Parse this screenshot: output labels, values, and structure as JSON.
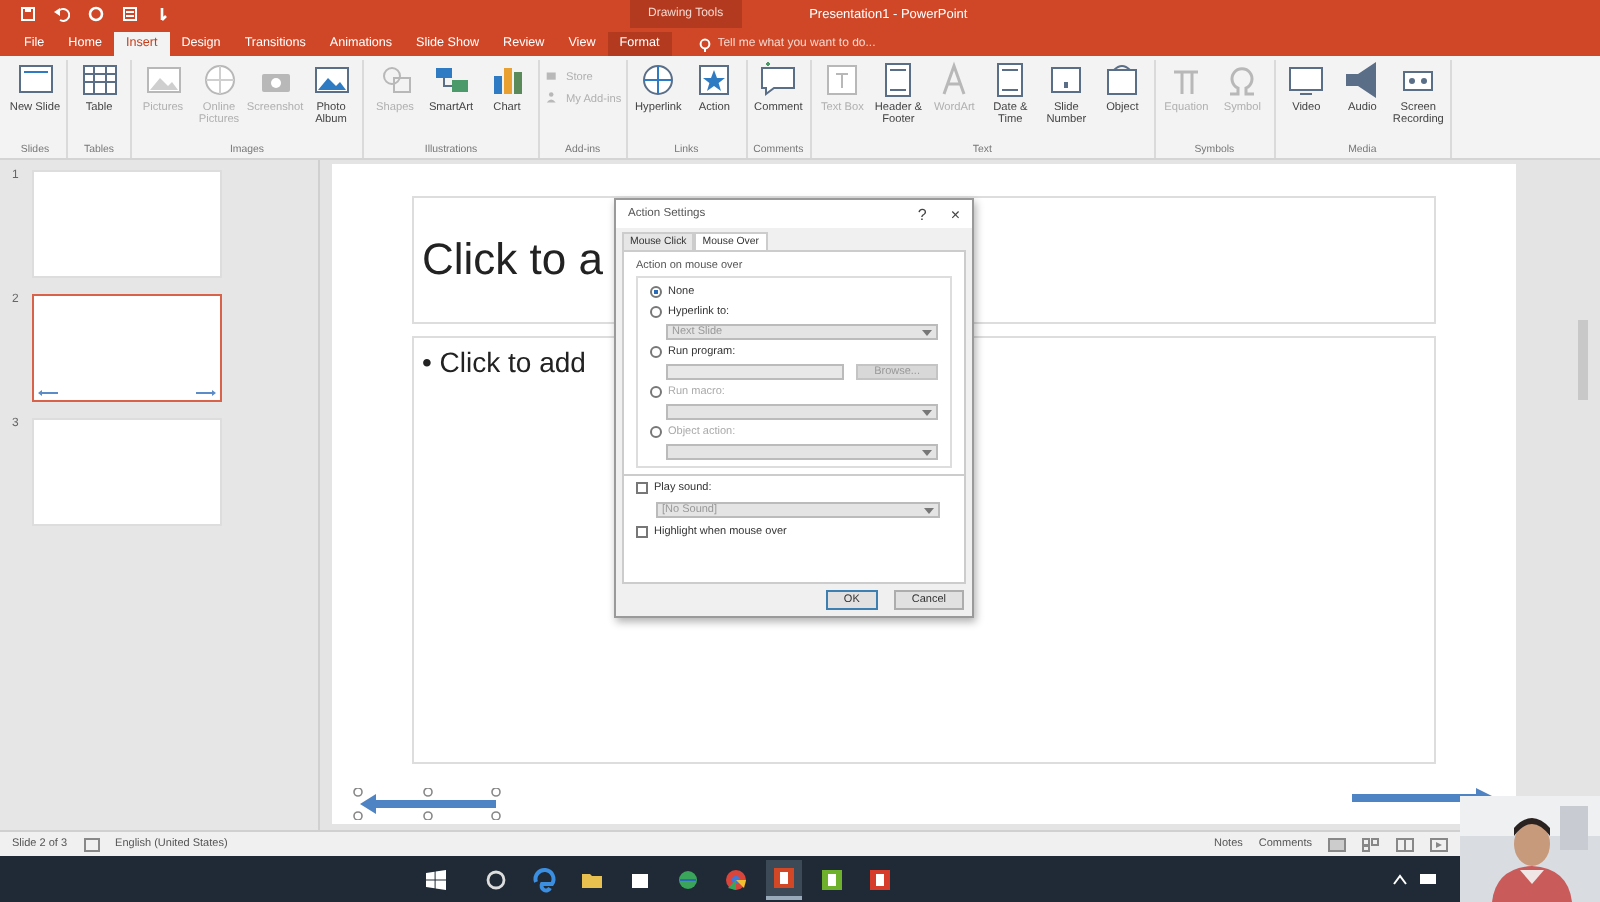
{
  "window": {
    "title": "Presentation1 - PowerPoint",
    "contextual_label": "Drawing Tools"
  },
  "tabs": [
    {
      "label": "File",
      "selected": false,
      "contextual": false
    },
    {
      "label": "Home",
      "selected": false,
      "contextual": false
    },
    {
      "label": "Insert",
      "selected": true,
      "contextual": false
    },
    {
      "label": "Design",
      "selected": false,
      "contextual": false
    },
    {
      "label": "Transitions",
      "selected": false,
      "contextual": false
    },
    {
      "label": "Animations",
      "selected": false,
      "contextual": false
    },
    {
      "label": "Slide Show",
      "selected": false,
      "contextual": false
    },
    {
      "label": "Review",
      "selected": false,
      "contextual": false
    },
    {
      "label": "View",
      "selected": false,
      "contextual": false
    },
    {
      "label": "Format",
      "selected": false,
      "contextual": true
    }
  ],
  "tell_me": {
    "placeholder": "Tell me what you want to do..."
  },
  "ribbon": [
    {
      "label": "Slides",
      "stacked": false,
      "commands": [
        {
          "label": "New Slide",
          "kind": "slide",
          "disabled": false
        }
      ]
    },
    {
      "label": "Tables",
      "stacked": false,
      "commands": [
        {
          "label": "Table",
          "kind": "table",
          "disabled": false
        }
      ]
    },
    {
      "label": "Images",
      "stacked": false,
      "commands": [
        {
          "label": "Pictures",
          "kind": "picture",
          "disabled": true
        },
        {
          "label": "Online Pictures",
          "kind": "globe",
          "disabled": true
        },
        {
          "label": "Screenshot",
          "kind": "camera",
          "disabled": true
        },
        {
          "label": "Photo Album",
          "kind": "picture",
          "disabled": false
        }
      ]
    },
    {
      "label": "Illustrations",
      "stacked": false,
      "commands": [
        {
          "label": "Shapes",
          "kind": "shapes",
          "disabled": true
        },
        {
          "label": "SmartArt",
          "kind": "smartart",
          "disabled": false
        },
        {
          "label": "Chart",
          "kind": "chart",
          "disabled": false
        }
      ]
    },
    {
      "label": "Add-ins",
      "stacked": true,
      "commands": [
        {
          "label": "Store",
          "kind": "store",
          "disabled": true
        },
        {
          "label": "My Add-ins",
          "kind": "person",
          "disabled": true
        }
      ]
    },
    {
      "label": "Links",
      "stacked": false,
      "commands": [
        {
          "label": "Hyperlink",
          "kind": "globe",
          "disabled": false
        },
        {
          "label": "Action",
          "kind": "star",
          "disabled": false
        }
      ]
    },
    {
      "label": "Comments",
      "stacked": false,
      "commands": [
        {
          "label": "Comment",
          "kind": "comment",
          "disabled": false
        }
      ]
    },
    {
      "label": "Text",
      "stacked": false,
      "commands": [
        {
          "label": "Text Box",
          "kind": "textbox",
          "disabled": true
        },
        {
          "label": "Header & Footer",
          "kind": "document",
          "disabled": false
        },
        {
          "label": "WordArt",
          "kind": "wordart",
          "disabled": true
        },
        {
          "label": "Date & Time",
          "kind": "document",
          "disabled": false
        },
        {
          "label": "Slide Number",
          "kind": "hash",
          "disabled": false
        },
        {
          "label": "Object",
          "kind": "object",
          "disabled": false
        }
      ]
    },
    {
      "label": "Symbols",
      "stacked": false,
      "commands": [
        {
          "label": "Equation",
          "kind": "pi",
          "disabled": true
        },
        {
          "label": "Symbol",
          "kind": "omega",
          "disabled": true
        }
      ]
    },
    {
      "label": "Media",
      "stacked": false,
      "commands": [
        {
          "label": "Video",
          "kind": "screen",
          "disabled": false
        },
        {
          "label": "Audio",
          "kind": "speaker",
          "disabled": false
        },
        {
          "label": "Screen Recording",
          "kind": "record",
          "disabled": false
        }
      ]
    }
  ],
  "thumbnails": [
    {
      "number": "1",
      "selected": false,
      "arrows": false
    },
    {
      "number": "2",
      "selected": true,
      "arrows": true
    },
    {
      "number": "3",
      "selected": false,
      "arrows": false
    }
  ],
  "slide": {
    "title_placeholder": "Click to a",
    "body_placeholder": "• Click to add"
  },
  "dialog": {
    "title": "Action Settings",
    "help": "?",
    "close": "×",
    "tabs": [
      {
        "label": "Mouse Click",
        "selected": false
      },
      {
        "label": "Mouse Over",
        "selected": true
      }
    ],
    "group_label": "Action on mouse over",
    "options": [
      {
        "kind": "radio",
        "label": "None",
        "selected": true,
        "disabled": false
      },
      {
        "kind": "radio",
        "label": "Hyperlink to:",
        "selected": false,
        "disabled": false
      },
      {
        "kind": "dropdown",
        "value": "Next Slide",
        "disabled": true
      },
      {
        "kind": "radio",
        "label": "Run program:",
        "selected": false,
        "disabled": false
      },
      {
        "kind": "browse",
        "button": "Browse...",
        "disabled": true
      },
      {
        "kind": "radio",
        "label": "Run macro:",
        "selected": false,
        "disabled": true
      },
      {
        "kind": "dropdown",
        "disabled": true
      },
      {
        "kind": "radio",
        "label": "Object action:",
        "selected": false,
        "disabled": true
      },
      {
        "kind": "dropdown",
        "disabled": true
      }
    ],
    "extras": [
      {
        "kind": "checkbox",
        "label": "Play sound:",
        "checked": false
      },
      {
        "kind": "dropdown",
        "value": "[No Sound]"
      },
      {
        "kind": "checkbox",
        "label": "Highlight when mouse over",
        "checked": false
      }
    ],
    "buttons": [
      {
        "label": "OK",
        "default": true
      },
      {
        "label": "Cancel",
        "default": false
      }
    ]
  },
  "status_bar": {
    "slide": "Slide 2 of 3",
    "language": "English (United States)",
    "notes": "Notes",
    "comments": "Comments"
  },
  "taskbar": [
    {
      "kind": "cortana",
      "active": false
    },
    {
      "kind": "edge",
      "active": false
    },
    {
      "kind": "folder",
      "active": false
    },
    {
      "kind": "store",
      "active": false
    },
    {
      "kind": "globe",
      "active": false
    },
    {
      "kind": "chrome",
      "active": false
    },
    {
      "kind": "powerpoint",
      "active": true
    },
    {
      "kind": "green",
      "active": false
    },
    {
      "kind": "red",
      "active": false
    }
  ]
}
